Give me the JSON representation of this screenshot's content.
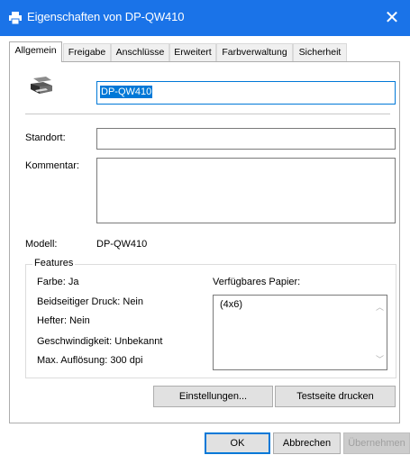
{
  "window": {
    "title": "Eigenschaften von DP-QW410",
    "close_glyph": "✕"
  },
  "tabs": [
    {
      "label": "Allgemein",
      "active": true
    },
    {
      "label": "Freigabe",
      "active": false
    },
    {
      "label": "Anschlüsse",
      "active": false
    },
    {
      "label": "Erweitert",
      "active": false
    },
    {
      "label": "Farbverwaltung",
      "active": false
    },
    {
      "label": "Sicherheit",
      "active": false
    }
  ],
  "general": {
    "printer_name": "DP-QW410",
    "location_label": "Standort:",
    "location_value": "",
    "comment_label": "Kommentar:",
    "comment_value": "",
    "model_label": "Modell:",
    "model_value": "DP-QW410"
  },
  "features": {
    "legend": "Features",
    "color": "Farbe: Ja",
    "duplex": "Beidseitiger Druck: Nein",
    "staple": "Hefter: Nein",
    "speed": "Geschwindigkeit: Unbekannt",
    "resolution": "Max. Auflösung: 300 dpi",
    "paper_label": "Verfügbares Papier:",
    "paper_items": [
      "(4x6)"
    ]
  },
  "buttons": {
    "preferences": "Einstellungen...",
    "test_page": "Testseite drucken",
    "ok": "OK",
    "cancel": "Abbrechen",
    "apply": "Übernehmen"
  },
  "colors": {
    "titlebar": "#1a73e8",
    "selection": "#0078d7"
  }
}
